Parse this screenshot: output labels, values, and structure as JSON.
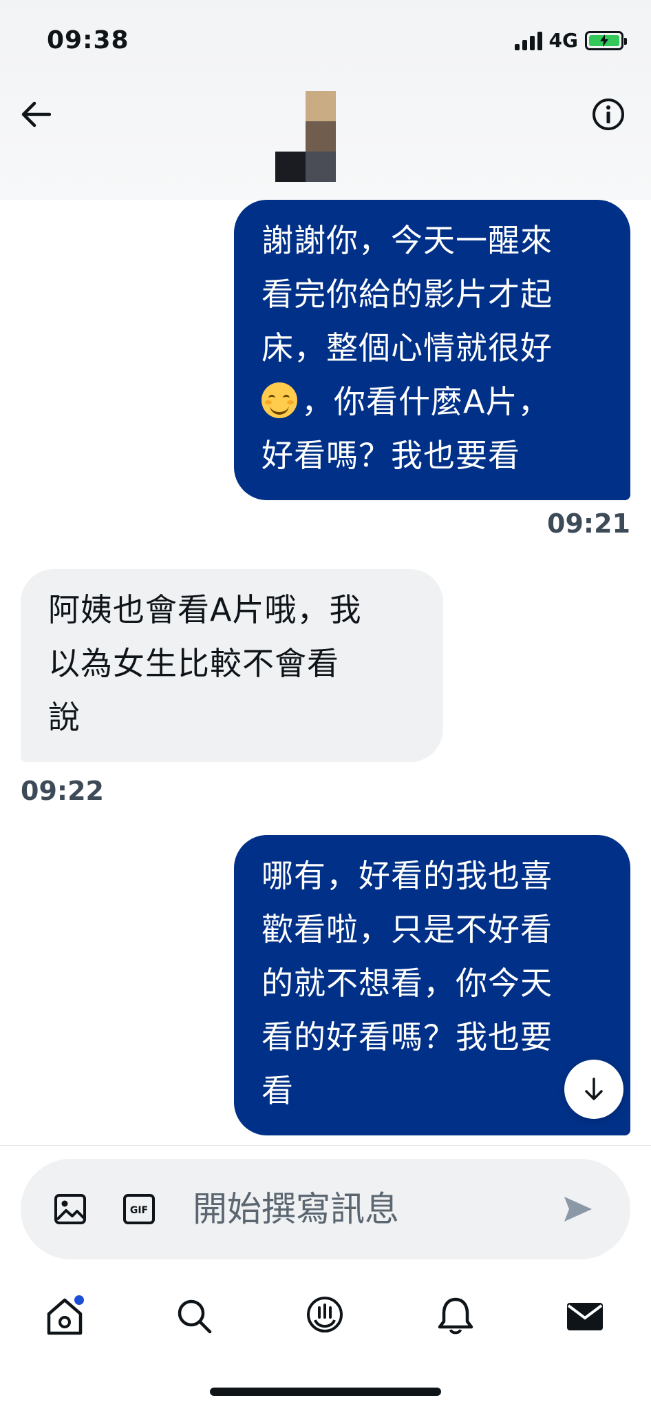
{
  "status_bar": {
    "time": "09:38",
    "network": "4G"
  },
  "messages": [
    {
      "direction": "outgoing",
      "lines": [
        "謝謝你，今天一醒來",
        "看完你給的影片才起",
        "床，整個心情就很好",
        "，你看什麼A片，",
        "好看嗎？我也要看"
      ],
      "time": "09:21"
    },
    {
      "direction": "incoming",
      "lines": [
        "阿姨也會看A片哦，我",
        "以為女生比較不會看",
        "說"
      ],
      "time": "09:22"
    },
    {
      "direction": "outgoing",
      "lines": [
        "哪有，好看的我也喜",
        "歡看啦，只是不好看",
        "的就不想看，你今天",
        "看的好看嗎？我也要",
        "看"
      ]
    }
  ],
  "composer": {
    "placeholder": "開始撰寫訊息"
  },
  "colors": {
    "outgoing_bubble": "#003087",
    "incoming_bubble": "#eff1f3",
    "accent": "#1d9bf0"
  },
  "icons": [
    "back-arrow-icon",
    "info-icon",
    "image-icon",
    "gif-icon",
    "send-icon",
    "home-icon",
    "search-icon",
    "spaces-icon",
    "bell-icon",
    "mail-icon",
    "arrow-down-icon"
  ]
}
